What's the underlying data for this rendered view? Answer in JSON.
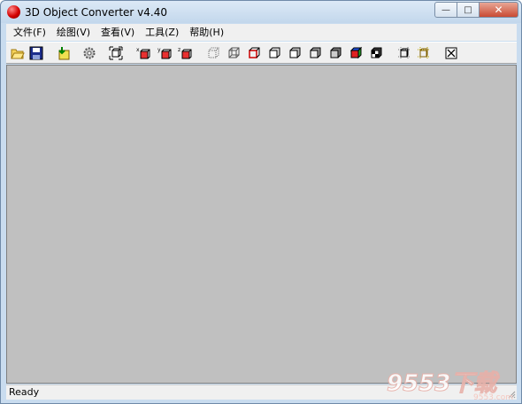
{
  "window": {
    "title": "3D Object Converter v4.40",
    "minimize_glyph": "—",
    "maximize_glyph": "□",
    "close_glyph": "✕"
  },
  "menu": [
    {
      "label": "文件(F)"
    },
    {
      "label": "绘图(V)"
    },
    {
      "label": "查看(V)"
    },
    {
      "label": "工具(Z)"
    },
    {
      "label": "帮助(H)"
    }
  ],
  "toolbar": {
    "axis_x": "x",
    "axis_y": "y",
    "axis_z": "z",
    "buttons": [
      "open-folder-icon",
      "save-disk-icon",
      "import-icon",
      "settings-gear-icon",
      "fit-view-icon",
      "rotate-x-icon",
      "rotate-y-icon",
      "rotate-z-icon",
      "view-points-icon",
      "view-wireframe-icon",
      "view-front-icon",
      "view-cube-1-icon",
      "view-cube-2-icon",
      "view-cube-3-icon",
      "view-cube-4-icon",
      "view-colored-icon",
      "view-checker-icon",
      "view-grid-1-icon",
      "view-grid-2-icon",
      "close-view-icon"
    ]
  },
  "status": {
    "text": "Ready"
  },
  "watermark": {
    "text": "9553下载",
    "url": "9553.com"
  },
  "colors": {
    "client_area": "#c0c0c0",
    "title_bar": "#c9dcef",
    "close_button": "#c94a32",
    "app_icon": "#d40000"
  }
}
